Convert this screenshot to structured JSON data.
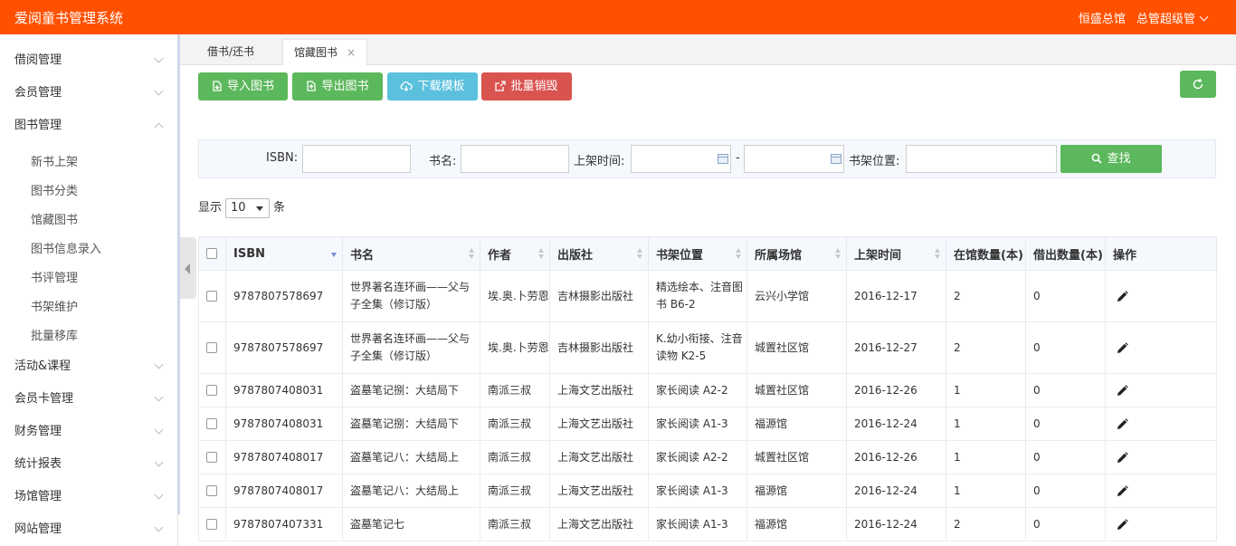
{
  "app": {
    "title": "爱阅童书管理系统",
    "branch": "恒盛总馆",
    "user": "总管超级管"
  },
  "sidebar": {
    "items": [
      {
        "label": "借阅管理"
      },
      {
        "label": "会员管理"
      },
      {
        "label": "图书管理"
      },
      {
        "label": "活动&课程"
      },
      {
        "label": "会员卡管理"
      },
      {
        "label": "财务管理"
      },
      {
        "label": "统计报表"
      },
      {
        "label": "场馆管理"
      },
      {
        "label": "网站管理"
      }
    ],
    "subitems": [
      {
        "label": "新书上架"
      },
      {
        "label": "图书分类"
      },
      {
        "label": "馆藏图书"
      },
      {
        "label": "图书信息录入"
      },
      {
        "label": "书评管理"
      },
      {
        "label": "书架维护"
      },
      {
        "label": "批量移库"
      }
    ]
  },
  "tabs": [
    {
      "label": "借书/还书"
    },
    {
      "label": "馆藏图书",
      "close": "×"
    }
  ],
  "toolbar": {
    "import": "导入图书",
    "export": "导出图书",
    "template": "下载模板",
    "destroy": "批量销毁",
    "colors": {
      "green": "#5cb85c",
      "blue": "#5bc0de",
      "red": "#d9534f"
    }
  },
  "search": {
    "isbn_label": "ISBN:",
    "name_label": "书名:",
    "date_label": "上架时间:",
    "dash": "-",
    "shelf_label": "书架位置:",
    "button": "查找"
  },
  "pagesize": {
    "prefix": "显示",
    "value": "10",
    "suffix": "条"
  },
  "table": {
    "headers": [
      "ISBN",
      "书名",
      "作者",
      "出版社",
      "书架位置",
      "所属场馆",
      "上架时间",
      "在馆数量(本)",
      "借出数量(本)",
      "操作"
    ],
    "rows": [
      [
        "9787807578697",
        "世界著名连环画——父与子全集（修订版）",
        "埃.奥.卜劳恩",
        "吉林摄影出版社",
        "精选绘本、注音图书 B6-2",
        "云兴小学馆",
        "2016-12-17",
        "2",
        "0"
      ],
      [
        "9787807578697",
        "世界著名连环画——父与子全集（修订版）",
        "埃.奥.卜劳恩",
        "吉林摄影出版社",
        "K.幼小衔接、注音读物 K2-5",
        "城置社区馆",
        "2016-12-27",
        "2",
        "0"
      ],
      [
        "9787807408031",
        "盗墓笔记捌：大结局下",
        "南派三叔",
        "上海文艺出版社",
        "家长阅读 A2-2",
        "城置社区馆",
        "2016-12-26",
        "1",
        "0"
      ],
      [
        "9787807408031",
        "盗墓笔记捌：大结局下",
        "南派三叔",
        "上海文艺出版社",
        "家长阅读 A1-3",
        "福源馆",
        "2016-12-24",
        "1",
        "0"
      ],
      [
        "9787807408017",
        "盗墓笔记八：大结局上",
        "南派三叔",
        "上海文艺出版社",
        "家长阅读 A2-2",
        "城置社区馆",
        "2016-12-26",
        "1",
        "0"
      ],
      [
        "9787807408017",
        "盗墓笔记八：大结局上",
        "南派三叔",
        "上海文艺出版社",
        "家长阅读 A1-3",
        "福源馆",
        "2016-12-24",
        "1",
        "0"
      ],
      [
        "9787807407331",
        "盗墓笔记七",
        "南派三叔",
        "上海文艺出版社",
        "家长阅读 A1-3",
        "福源馆",
        "2016-12-24",
        "2",
        "0"
      ]
    ]
  }
}
